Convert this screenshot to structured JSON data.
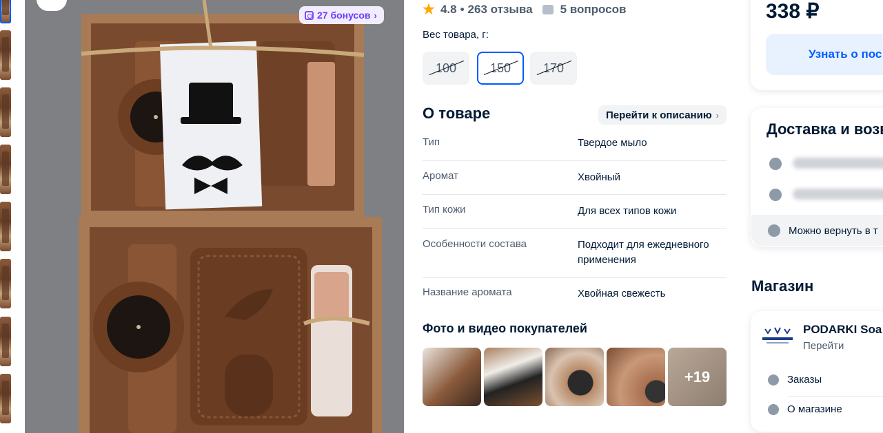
{
  "gallery": {
    "bonus_badge": "27 бонусов",
    "thumbnails_count": 8
  },
  "product": {
    "rating": "4.8",
    "reviews": "263 отзыва",
    "questions": "5 вопросов",
    "weight_label": "Вес товара, г:",
    "weight_options": [
      {
        "label": "100",
        "selected": false,
        "unavailable": true
      },
      {
        "label": "150",
        "selected": true,
        "unavailable": true
      },
      {
        "label": "170",
        "selected": false,
        "unavailable": true
      }
    ]
  },
  "about": {
    "title": "О товаре",
    "goto_description": "Перейти к описанию",
    "specs": [
      {
        "name": "Тип",
        "value": "Твердое мыло"
      },
      {
        "name": "Аромат",
        "value": "Хвойный"
      },
      {
        "name": "Тип кожи",
        "value": "Для всех типов кожи"
      },
      {
        "name": "Особенности состава",
        "value": "Подходит для ежедневного применения"
      },
      {
        "name": "Название аромата",
        "value": "Хвойная свежесть"
      }
    ]
  },
  "customer_photos": {
    "title": "Фото и видео покупателей",
    "more": "+19"
  },
  "buy": {
    "price": "338 ₽",
    "learn_button": "Узнать о пос"
  },
  "delivery": {
    "title": "Доставка и возв",
    "return_text": "Можно вернуть в т"
  },
  "shop": {
    "title": "Магазин",
    "name": "PODARKI Soa",
    "goto": "Перейти",
    "links": [
      "Заказы",
      "О магазине"
    ]
  },
  "colors": {
    "accent": "#005bff",
    "bonus": "#6b3cf5",
    "star": "#ffa800",
    "text": "#001a34"
  },
  "icons": [
    "zoom-icon",
    "bonus-icon",
    "star-icon",
    "question-icon",
    "chevron-right-icon",
    "location-icon",
    "clock-icon",
    "return-icon",
    "orders-icon",
    "info-icon"
  ]
}
